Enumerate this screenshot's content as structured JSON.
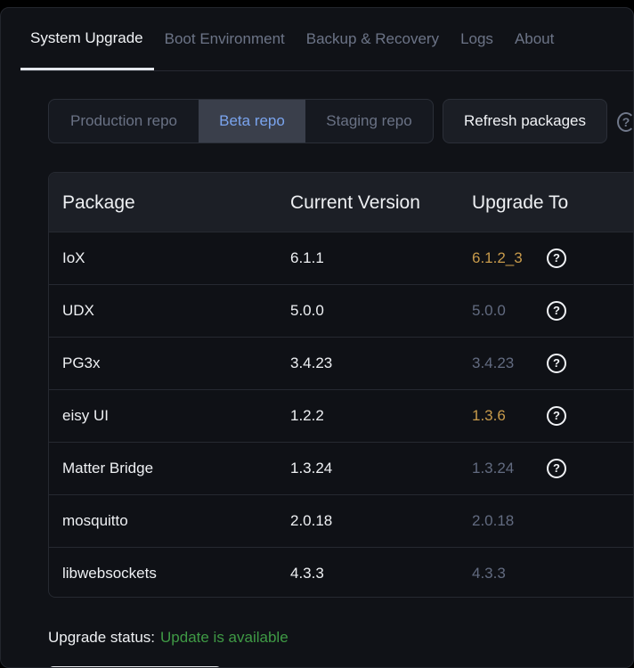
{
  "tabs": [
    {
      "label": "System Upgrade",
      "active": true
    },
    {
      "label": "Boot Environment",
      "active": false
    },
    {
      "label": "Backup & Recovery",
      "active": false
    },
    {
      "label": "Logs",
      "active": false
    },
    {
      "label": "About",
      "active": false
    }
  ],
  "repos": [
    {
      "label": "Production repo",
      "active": false
    },
    {
      "label": "Beta repo",
      "active": true
    },
    {
      "label": "Staging repo",
      "active": false
    }
  ],
  "refresh_label": "Refresh packages",
  "help_icon": "?",
  "table": {
    "headers": [
      "Package",
      "Current Version",
      "Upgrade To"
    ],
    "rows": [
      {
        "package": "IoX",
        "current": "6.1.1",
        "upgrade": "6.1.2_3",
        "style": "accent",
        "help": "?"
      },
      {
        "package": "UDX",
        "current": "5.0.0",
        "upgrade": "5.0.0",
        "style": "muted",
        "help": "?"
      },
      {
        "package": "PG3x",
        "current": "3.4.23",
        "upgrade": "3.4.23",
        "style": "muted",
        "help": "?"
      },
      {
        "package": "eisy UI",
        "current": "1.2.2",
        "upgrade": "1.3.6",
        "style": "accent",
        "help": "?"
      },
      {
        "package": "Matter Bridge",
        "current": "1.3.24",
        "upgrade": "1.3.24",
        "style": "muted",
        "help": "?"
      },
      {
        "package": "mosquitto",
        "current": "2.0.18",
        "upgrade": "2.0.18",
        "style": "muted",
        "help": ""
      },
      {
        "package": "libwebsockets",
        "current": "4.3.3",
        "upgrade": "4.3.3",
        "style": "muted",
        "help": ""
      }
    ]
  },
  "status": {
    "label": "Upgrade status:",
    "value": "Update is available"
  },
  "colors": {
    "accent": "#c79a4b",
    "muted": "#626b80",
    "status_ok": "#3f9a45",
    "active_repo": "#7aa4ee"
  }
}
